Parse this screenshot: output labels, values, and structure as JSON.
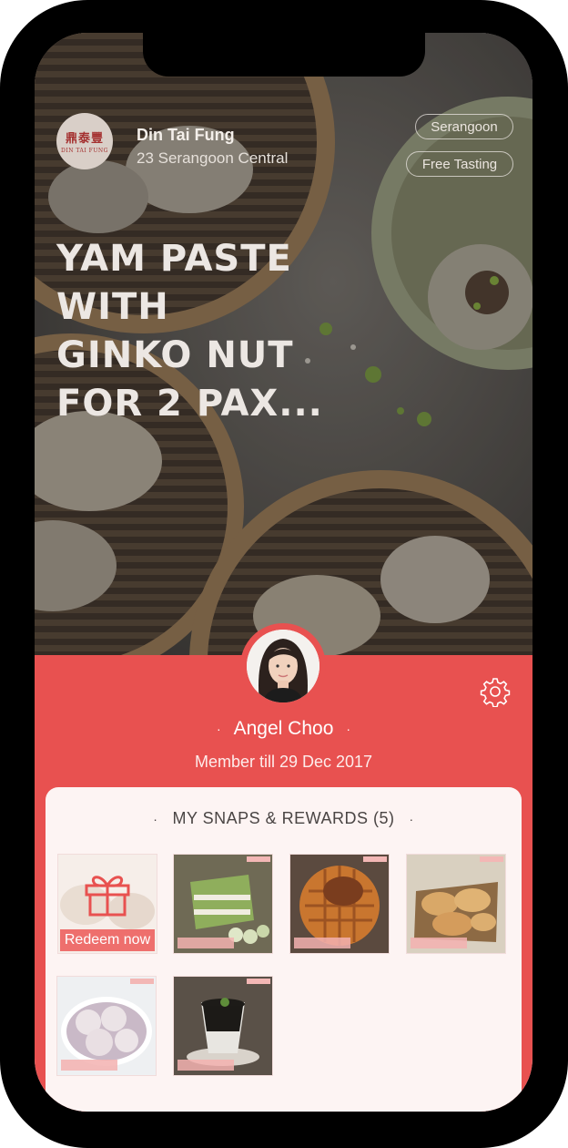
{
  "restaurant": {
    "logo_cn": "鼎泰豐",
    "logo_en": "DIN TAI FUNG",
    "name": "Din Tai Fung",
    "address": "23 Serangoon Central"
  },
  "chips": [
    "Serangoon",
    "Free Tasting"
  ],
  "headline": [
    "YAM PASTE",
    "WITH",
    "GINKO NUT",
    "FOR 2 PAX..."
  ],
  "user": {
    "name": "Angel Choo",
    "dot": "·",
    "member_text": "Member till 29 Dec 2017"
  },
  "rewards": {
    "title": "MY SNAPS & REWARDS (5)",
    "redeem_label": "Redeem now",
    "items": [
      "gift-voucher",
      "green-tea-cake",
      "chicken-waffle",
      "pan-fried-dumplings",
      "steamed-yam-buns",
      "herbal-jelly-dessert"
    ]
  },
  "colors": {
    "accent": "#e85150",
    "card_bg": "#fdf4f3",
    "redeem": "#ee6f6d"
  },
  "icons": {
    "settings": "gear-icon",
    "gift": "gift-icon"
  }
}
